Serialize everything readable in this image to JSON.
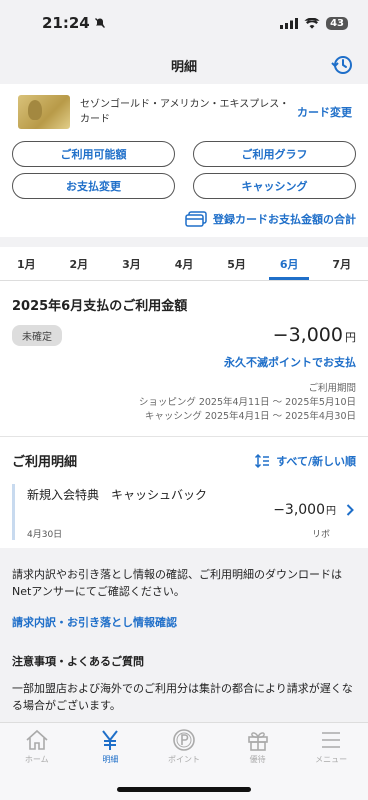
{
  "status_bar": {
    "time": "21:24",
    "battery": "43"
  },
  "nav": {
    "title": "明細"
  },
  "card": {
    "name": "セゾンゴールド・アメリカン・エキスプレス・カード",
    "change_label": "カード変更"
  },
  "actions": {
    "available": "ご利用可能額",
    "graph": "ご利用グラフ",
    "payment_change": "お支払変更",
    "cashing": "キャッシング"
  },
  "total_link": "登録カードお支払金額の合計",
  "month_tabs": [
    "1月",
    "2月",
    "3月",
    "4月",
    "5月",
    "6月",
    "7月"
  ],
  "active_month_index": 5,
  "summary": {
    "title": "2025年6月支払のご利用金額",
    "status": "未確定",
    "amount": "−3,000",
    "unit": "円",
    "points_link": "永久不滅ポイントでお支払",
    "period_label": "ご利用期間",
    "shopping_period": "ショッピング 2025年4月11日 〜 2025年5月10日",
    "cashing_period": "キャッシング 2025年4月1日 〜 2025年4月30日"
  },
  "details": {
    "title": "ご利用明細",
    "sort_label": "すべて/新しい順",
    "items": [
      {
        "name": "新規入会特典　キャッシュバック",
        "amount": "−3,000",
        "unit": "円",
        "date": "4月30日",
        "type": "リボ"
      }
    ]
  },
  "info": {
    "text": "請求内訳やお引き落とし情報の確認、ご利用明細のダウンロードはNetアンサーにてご確認ください。",
    "link": "請求内訳・お引き落とし情報確認",
    "notes_title": "注意事項・よくあるご質問",
    "notes_body": "一部加盟店および海外でのご利用分は集計の都合により請求が遅くなる場合がございます。"
  },
  "tabbar": {
    "home": "ホーム",
    "statement": "明細",
    "points": "ポイント",
    "benefits": "優待",
    "menu": "メニュー"
  },
  "colors": {
    "accent": "#1f6fc9",
    "background": "#f2f2f4"
  }
}
